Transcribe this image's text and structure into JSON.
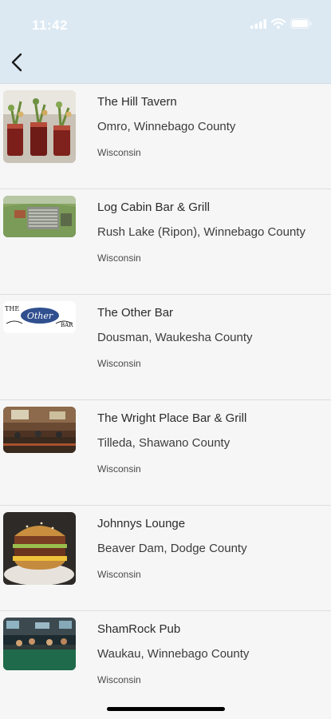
{
  "status_bar": {
    "time": "11:42"
  },
  "nav": {
    "back_icon": "chevron-left-icon"
  },
  "colors": {
    "header_bg": "#dce9f3",
    "page_bg": "#f6f6f6",
    "divider": "#dedede"
  },
  "bars": [
    {
      "name": "The Hill Tavern",
      "location": "Omro, Winnebago County",
      "state": "Wisconsin"
    },
    {
      "name": "Log Cabin Bar & Grill",
      "location": "Rush Lake (Ripon), Winnebago County",
      "state": "Wisconsin"
    },
    {
      "name": "The Other Bar",
      "location": "Dousman, Waukesha County",
      "state": "Wisconsin",
      "logo_text": {
        "left": "THE",
        "center": "Other",
        "right": "BAR"
      }
    },
    {
      "name": "The Wright Place Bar & Grill",
      "location": "Tilleda, Shawano County",
      "state": "Wisconsin"
    },
    {
      "name": "Johnnys Lounge",
      "location": "Beaver Dam, Dodge County",
      "state": "Wisconsin"
    },
    {
      "name": "ShamRock Pub",
      "location": "Waukau, Winnebago County",
      "state": "Wisconsin"
    }
  ]
}
